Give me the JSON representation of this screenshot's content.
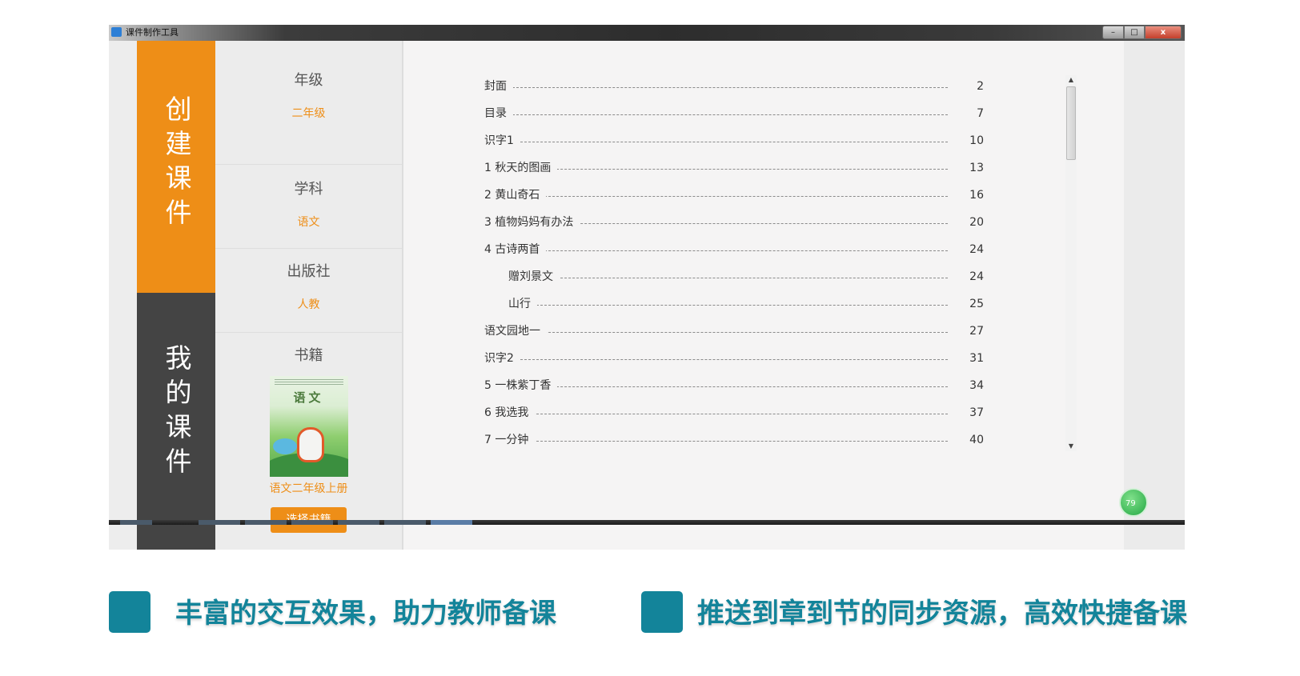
{
  "window": {
    "title": "课件制作工具",
    "buttons": {
      "minimize": "–",
      "maximize": "□",
      "close": "x"
    }
  },
  "nav": {
    "create_label": "创建课件",
    "mine_label": "我的课件"
  },
  "filters": {
    "grade": {
      "label": "年级",
      "value": "二年级"
    },
    "subject": {
      "label": "学科",
      "value": "语文"
    },
    "publisher": {
      "label": "出版社",
      "value": "人教"
    },
    "book": {
      "label": "书籍",
      "cover_title": "语文",
      "name": "语文二年级上册",
      "choose_button": "选择书籍"
    }
  },
  "toc": [
    {
      "title": "封面",
      "page": "2",
      "indent": false
    },
    {
      "title": "目录",
      "page": "7",
      "indent": false
    },
    {
      "title": "识字1",
      "page": "10",
      "indent": false
    },
    {
      "title": "1 秋天的图画",
      "page": "13",
      "indent": false
    },
    {
      "title": "2 黄山奇石",
      "page": "16",
      "indent": false
    },
    {
      "title": "3 植物妈妈有办法",
      "page": "20",
      "indent": false
    },
    {
      "title": "4 古诗两首",
      "page": "24",
      "indent": false
    },
    {
      "title": "赠刘景文",
      "page": "24",
      "indent": true
    },
    {
      "title": "山行",
      "page": "25",
      "indent": true
    },
    {
      "title": "语文园地一",
      "page": "27",
      "indent": false
    },
    {
      "title": "识字2",
      "page": "31",
      "indent": false
    },
    {
      "title": "5 一株紫丁香",
      "page": "34",
      "indent": false
    },
    {
      "title": "6 我选我",
      "page": "37",
      "indent": false
    },
    {
      "title": "7 一分钟",
      "page": "40",
      "indent": false
    }
  ],
  "scrollbar": {
    "position_fraction": 0.0
  },
  "floating_badge": {
    "text": "79"
  },
  "features": [
    {
      "text": "丰富的交互效果，助力教师备课"
    },
    {
      "text": "推送到章到节的同步资源，高效快捷备课"
    }
  ],
  "colors": {
    "accent_orange": "#ee8e17",
    "nav_dark": "#444444",
    "feature_teal": "#13849a"
  }
}
